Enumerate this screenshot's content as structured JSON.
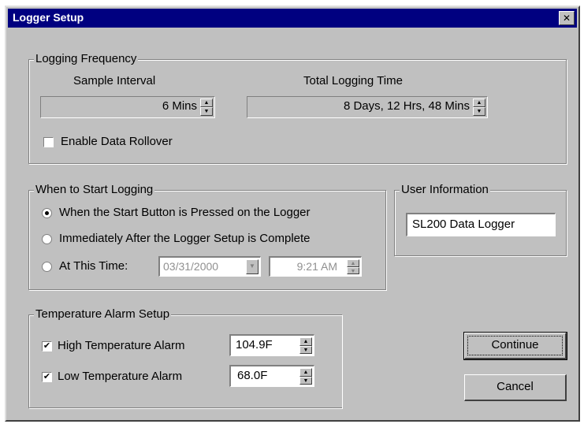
{
  "window": {
    "title": "Logger Setup",
    "close_label": "✕"
  },
  "logging_frequency": {
    "legend": "Logging Frequency",
    "sample_interval_label": "Sample Interval",
    "sample_interval_value": "6 Mins",
    "total_time_label": "Total Logging Time",
    "total_time_value": "8 Days, 12 Hrs, 48 Mins",
    "rollover_label": "Enable Data Rollover",
    "rollover_checked": false
  },
  "start_logging": {
    "legend": "When to Start Logging",
    "options": [
      {
        "label": "When the Start Button is Pressed on the Logger",
        "selected": true
      },
      {
        "label": "Immediately After the Logger Setup is Complete",
        "selected": false
      },
      {
        "label": "At This Time:",
        "selected": false
      }
    ],
    "date_value": "03/31/2000",
    "time_value": "9:21 AM"
  },
  "user_information": {
    "legend": "User Information",
    "value": "SL200 Data Logger"
  },
  "temperature_alarm": {
    "legend": "Temperature Alarm Setup",
    "high_label": "High Temperature Alarm",
    "high_checked": true,
    "high_value": "104.9F",
    "low_label": "Low Temperature Alarm",
    "low_checked": true,
    "low_value": "68.0F"
  },
  "buttons": {
    "continue_label": "Continue",
    "cancel_label": "Cancel"
  },
  "icons": {
    "check_mark": "✔",
    "spin_up": "▲",
    "spin_down": "▼",
    "dropdown": "▼"
  }
}
